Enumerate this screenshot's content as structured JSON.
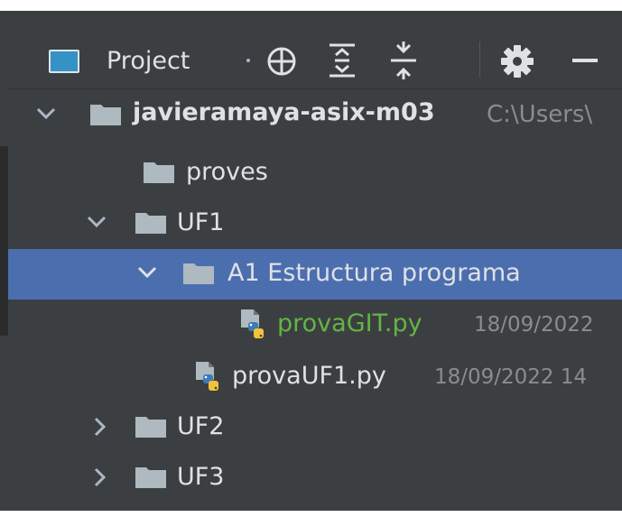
{
  "toolbar": {
    "title": "Project",
    "buttons": [
      "select-opened-file",
      "expand-all",
      "collapse-all",
      "settings",
      "hide"
    ]
  },
  "tree": {
    "root": {
      "label": "javieramaya-asix-m03",
      "path": "C:\\Users\\",
      "expanded": true
    },
    "proves": {
      "label": "proves"
    },
    "uf1": {
      "label": "UF1",
      "expanded": true
    },
    "a1": {
      "label": "A1 Estructura programa",
      "expanded": true,
      "selected": true
    },
    "provagit": {
      "label": "provaGIT.py",
      "date": "18/09/2022",
      "status_color": "#62b543"
    },
    "provauf1": {
      "label": "provaUF1.py",
      "date": "18/09/2022 14"
    },
    "uf2": {
      "label": "UF2",
      "expanded": false
    },
    "uf3": {
      "label": "UF3",
      "expanded": false
    }
  },
  "colors": {
    "panel_bg": "#3c3f41",
    "selection": "#4b6eaf",
    "text": "#dfe1e5",
    "vcs_added": "#62b543",
    "folder": "#aeb9c0"
  }
}
